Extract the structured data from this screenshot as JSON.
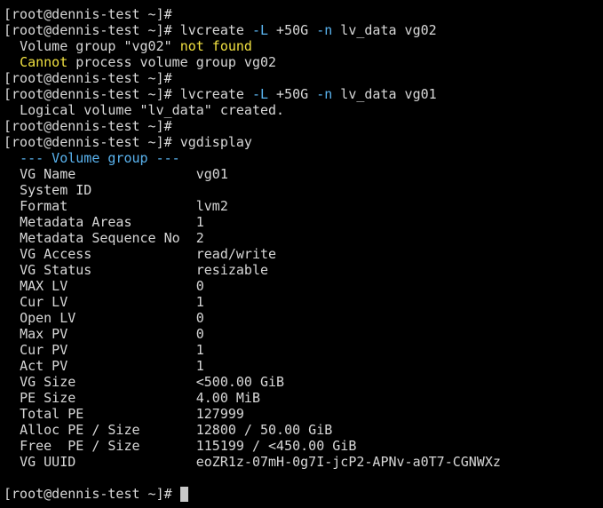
{
  "colors": {
    "background": "#000000",
    "text": "#d8d8d8",
    "highlight_yellow": "#f0e040",
    "option_blue": "#5ab4f0",
    "cursor": "#c8c8c8"
  },
  "prompt": "[root@dennis-test ~]# ",
  "cmd1": {
    "command": "lvcreate",
    "opt_L": "-L",
    "size": " +50G ",
    "opt_n": "-n",
    "args": " lv_data vg02"
  },
  "error": {
    "line1_pre": "Volume group \"vg02\" ",
    "line1_hl": "not found",
    "line2_hl": "Cannot",
    "line2_rest": " process volume group vg02"
  },
  "cmd2": {
    "command": "lvcreate",
    "opt_L": "-L",
    "size": " +50G ",
    "opt_n": "-n",
    "args": " lv_data vg01"
  },
  "created_msg": "Logical volume \"lv_data\" created.",
  "cmd3": {
    "command": "vgdisplay"
  },
  "vg_header": "--- Volume group ---",
  "vg_fields": [
    {
      "key": "VG Name",
      "value": "vg01"
    },
    {
      "key": "System ID",
      "value": ""
    },
    {
      "key": "Format",
      "value": "lvm2"
    },
    {
      "key": "Metadata Areas",
      "value": "1"
    },
    {
      "key": "Metadata Sequence No",
      "value": "2"
    },
    {
      "key": "VG Access",
      "value": "read/write"
    },
    {
      "key": "VG Status",
      "value": "resizable"
    },
    {
      "key": "MAX LV",
      "value": "0"
    },
    {
      "key": "Cur LV",
      "value": "1"
    },
    {
      "key": "Open LV",
      "value": "0"
    },
    {
      "key": "Max PV",
      "value": "0"
    },
    {
      "key": "Cur PV",
      "value": "1"
    },
    {
      "key": "Act PV",
      "value": "1"
    },
    {
      "key": "VG Size",
      "value": "<500.00 GiB"
    },
    {
      "key": "PE Size",
      "value": "4.00 MiB"
    },
    {
      "key": "Total PE",
      "value": "127999"
    },
    {
      "key": "Alloc PE / Size",
      "value": "12800 / 50.00 GiB"
    },
    {
      "key": "Free  PE / Size",
      "value": "115199 / <450.00 GiB"
    },
    {
      "key": "VG UUID",
      "value": "eoZR1z-07mH-0g7I-jcP2-APNv-a0T7-CGNWXz"
    }
  ]
}
